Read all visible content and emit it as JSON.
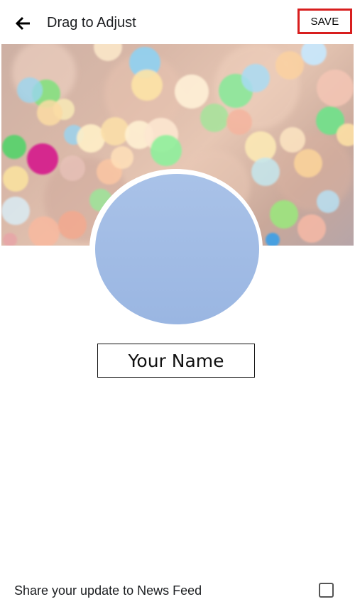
{
  "header": {
    "back_icon": "arrow-left-icon",
    "title": "Drag to Adjust",
    "save_label": "SAVE",
    "save_highlight_color": "#d81e1e"
  },
  "cover": {
    "description_icon": "bokeh-lights-image"
  },
  "profile": {
    "picture_color": "#9fbbe5",
    "name": "Your Name"
  },
  "footer": {
    "share_label": "Share your update to News Feed",
    "share_checked": false
  }
}
